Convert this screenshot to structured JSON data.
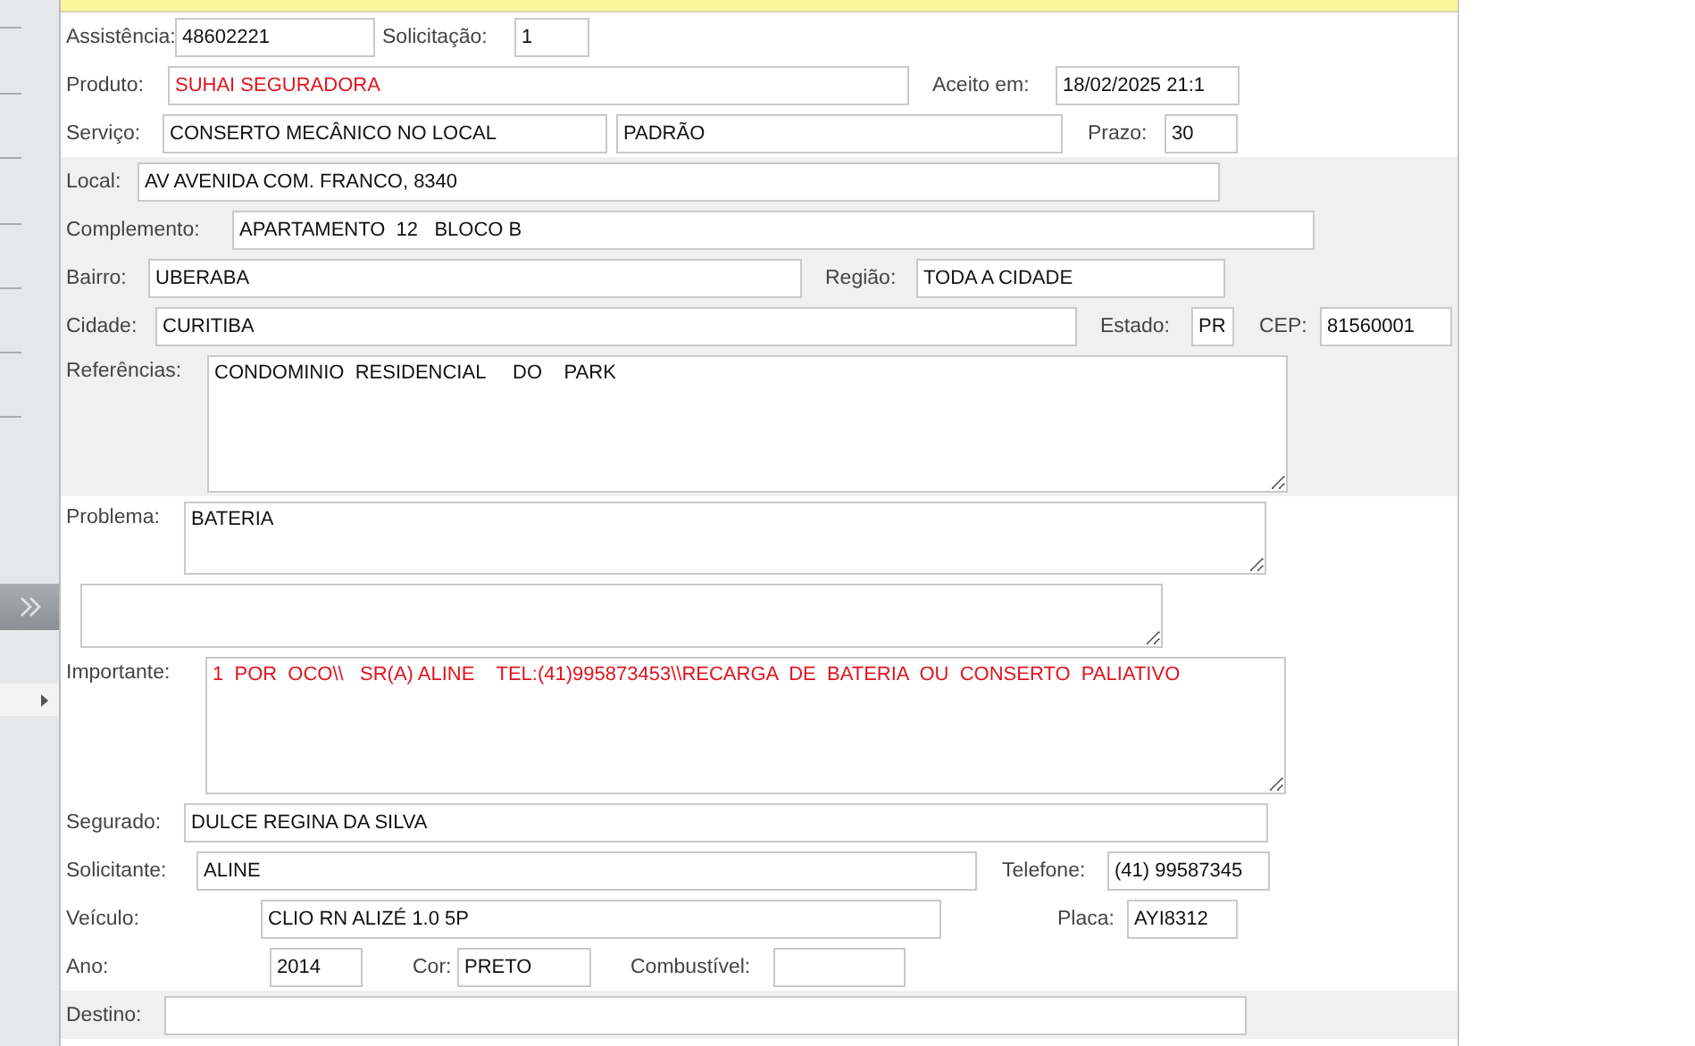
{
  "form": {
    "rows": [
      {
        "shaded": false,
        "fields": [
          {
            "label": "Assistência:",
            "value": "48602221",
            "kind": "input",
            "alert": false
          },
          {
            "label": "Solicitação:",
            "value": "1",
            "kind": "input",
            "alert": false
          }
        ]
      },
      {
        "shaded": false,
        "fields": [
          {
            "label": "Produto:",
            "value": "SUHAI SEGURADORA",
            "kind": "input",
            "alert": true
          },
          {
            "label": "Aceito em:",
            "value": "18/02/2025 21:1",
            "kind": "input",
            "alert": false
          }
        ]
      },
      {
        "shaded": false,
        "fields": [
          {
            "label": "Serviço:",
            "value": "CONSERTO MECÂNICO NO LOCAL",
            "kind": "input",
            "alert": false
          },
          {
            "value": "PADRÃO",
            "kind": "input",
            "alert": false
          },
          {
            "label": "Prazo:",
            "value": "30",
            "kind": "input",
            "alert": false
          }
        ]
      },
      {
        "shaded": true,
        "fields": [
          {
            "label": "Local:",
            "value": "AV AVENIDA COM. FRANCO, 8340",
            "kind": "input",
            "alert": false
          }
        ]
      },
      {
        "shaded": true,
        "fields": [
          {
            "label": "Complemento:",
            "value": "APARTAMENTO  12   BLOCO B",
            "kind": "input",
            "alert": false
          }
        ]
      },
      {
        "shaded": true,
        "fields": [
          {
            "label": "Bairro:",
            "value": "UBERABA",
            "kind": "input",
            "alert": false
          },
          {
            "label": "Região:",
            "value": "TODA A CIDADE",
            "kind": "input",
            "alert": false
          }
        ]
      },
      {
        "shaded": true,
        "fields": [
          {
            "label": "Cidade:",
            "value": "CURITIBA",
            "kind": "input",
            "alert": false
          },
          {
            "label": "Estado:",
            "value": "PR",
            "kind": "input",
            "alert": false
          },
          {
            "label": "CEP:",
            "value": "81560001",
            "kind": "input",
            "alert": false
          }
        ]
      },
      {
        "shaded": true,
        "fields": [
          {
            "label": "Referências:",
            "value": "CONDOMINIO  RESIDENCIAL     DO    PARK",
            "kind": "textarea",
            "alert": false
          }
        ]
      },
      {
        "shaded": false,
        "fields": [
          {
            "label": "Problema:",
            "value": "BATERIA",
            "kind": "textarea",
            "alert": false
          }
        ]
      },
      {
        "shaded": false,
        "fields": [
          {
            "kind": "textarea"
          }
        ]
      },
      {
        "shaded": false,
        "fields": [
          {
            "label": "Importante:",
            "value": "1  POR  OCO\\\\   SR(A) ALINE    TEL:(41)995873453\\\\RECARGA  DE  BATERIA  OU  CONSERTO  PALIATIVO",
            "kind": "textarea",
            "alert": true
          }
        ]
      },
      {
        "shaded": false,
        "fields": [
          {
            "label": "Segurado:",
            "value": "DULCE REGINA DA SILVA",
            "kind": "input",
            "alert": false
          }
        ]
      },
      {
        "shaded": false,
        "fields": [
          {
            "label": "Solicitante:",
            "value": "ALINE",
            "kind": "input",
            "alert": false
          },
          {
            "label": "Telefone:",
            "value": "(41) 99587345",
            "kind": "input",
            "alert": false
          }
        ]
      },
      {
        "shaded": false,
        "fields": [
          {
            "label": "Veículo:",
            "value": "CLIO RN ALIZÉ 1.0 5P",
            "kind": "input",
            "alert": false
          },
          {
            "label": "Placa:",
            "value": "AYI8312",
            "kind": "input",
            "alert": false
          }
        ]
      },
      {
        "shaded": false,
        "fields": [
          {
            "label": "Ano:",
            "value": "2014",
            "kind": "input",
            "alert": false
          },
          {
            "label": "Cor:",
            "value": "PRETO",
            "kind": "input",
            "alert": false
          },
          {
            "label": "Combustível:",
            "kind": "input"
          }
        ]
      },
      {
        "shaded": true,
        "fields": [
          {
            "label": "Destino:",
            "kind": "input"
          }
        ]
      }
    ]
  }
}
